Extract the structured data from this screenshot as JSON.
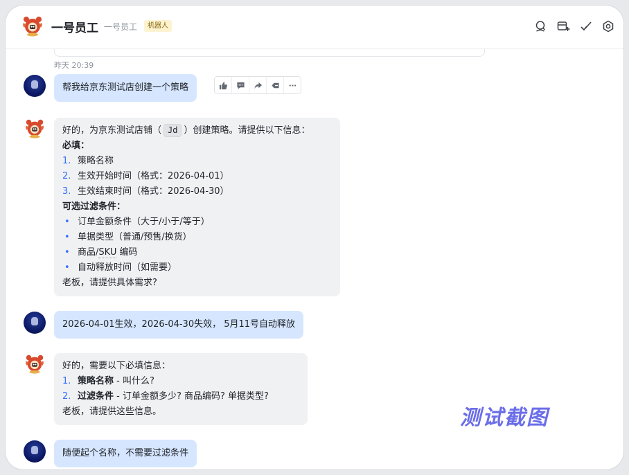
{
  "header": {
    "title": "一号员工",
    "subtitle": "一号员工",
    "badge": "机器人",
    "icons": [
      "search-chat-icon",
      "add-tab-icon",
      "task-check-icon",
      "settings-gear-icon"
    ]
  },
  "colors": {
    "user_bubble": "#d6e6ff",
    "bot_bubble": "#f0f1f3",
    "accent": "#3370ff",
    "watermark": "#6b6ee8"
  },
  "timestamp": "昨天 20:39",
  "messages": {
    "m1": {
      "text": "帮我给京东测试店创建一个策略"
    },
    "m2": {
      "intro_a": "好的，为京东测试店铺（",
      "code": "Jd",
      "intro_b": "）创建策略。请提供以下信息：",
      "required_title": "必填：",
      "required": [
        {
          "num": "1.",
          "text": "策略名称"
        },
        {
          "num": "2.",
          "text": "生效开始时间（格式：2026-04-01）"
        },
        {
          "num": "3.",
          "text": "生效结束时间（格式：2026-04-30）"
        }
      ],
      "optional_title": "可选过滤条件：",
      "optional": [
        {
          "bullet": "•",
          "text": "订单金额条件（大于/小于/等于）"
        },
        {
          "bullet": "•",
          "text": "单据类型（普通/预售/换货）"
        },
        {
          "bullet": "•",
          "text": "商品/",
          "underlined": "SKU",
          "tail": " 编码"
        },
        {
          "bullet": "•",
          "text": "自动释放时间（如需要）"
        }
      ],
      "closing": "老板，请提供具体需求?"
    },
    "m3": {
      "text": "2026-04-01生效，2026-04-30失效， 5月11号自动释放"
    },
    "m4": {
      "intro": "好的，需要以下必填信息：",
      "items": [
        {
          "num": "1.",
          "bold": "策略名称",
          "rest": " - 叫什么?"
        },
        {
          "num": "2.",
          "bold": "过滤条件",
          "rest": " - 订单金额多少? 商品编码? 单据类型?"
        }
      ],
      "closing": "老板，请提供这些信息。"
    },
    "m5": {
      "text": "随便起个名称，不需要过滤条件"
    }
  },
  "message_actions": [
    "thumbs-up-icon",
    "comment-icon",
    "forward-icon",
    "pin-icon",
    "more-icon"
  ],
  "watermark": "测试截图"
}
